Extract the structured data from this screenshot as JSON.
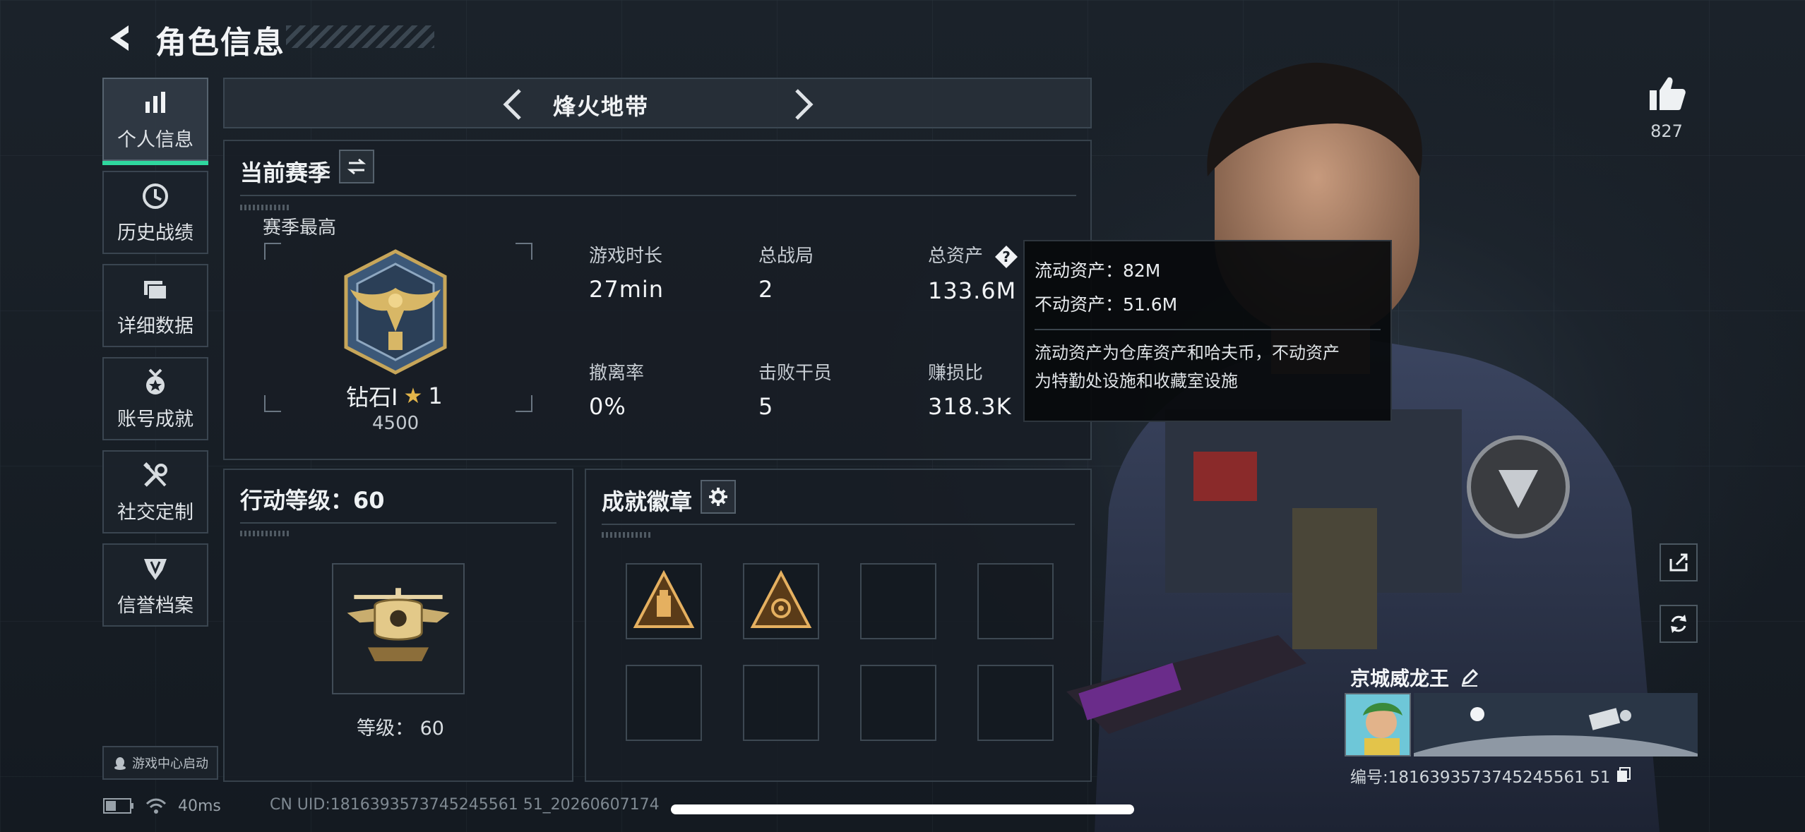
{
  "header": {
    "title": "角色信息"
  },
  "sidebar": {
    "items": [
      {
        "label": "个人信息",
        "icon": "bar-chart-icon",
        "active": true
      },
      {
        "label": "历史战绩",
        "icon": "clock-icon"
      },
      {
        "label": "详细数据",
        "icon": "folder-icon"
      },
      {
        "label": "账号成就",
        "icon": "medal-icon"
      },
      {
        "label": "社交定制",
        "icon": "tools-icon"
      },
      {
        "label": "信誉档案",
        "icon": "shield-badge-icon"
      }
    ],
    "game_center": "游戏中心启动"
  },
  "mode_selector": {
    "title": "烽火地带"
  },
  "season": {
    "title": "当前赛季",
    "best_label": "赛季最高",
    "rank_name": "钻石I",
    "rank_stars": "1",
    "rank_score": "4500",
    "stats": [
      {
        "label": "游戏时长",
        "value": "27min"
      },
      {
        "label": "总战局",
        "value": "2"
      },
      {
        "label": "总资产",
        "value": "133.6M"
      },
      {
        "label": "撤离率",
        "value": "0%"
      },
      {
        "label": "击败干员",
        "value": "5"
      },
      {
        "label": "赚损比",
        "value": "318.3K"
      }
    ]
  },
  "tooltip": {
    "liquid": "流动资产：82M",
    "fixed": "不动资产：51.6M",
    "desc_line1": "流动资产为仓库资产和哈夫币，不动资产",
    "desc_line2": "为特勤处设施和收藏室设施"
  },
  "level": {
    "title": "行动等级：60",
    "caption": "等级：  60"
  },
  "badges": {
    "title": "成就徽章",
    "slots_filled": 2,
    "slots_total": 8
  },
  "profile": {
    "likes": "827",
    "name": "京城威龙王",
    "id_label": "编号:1816393573745245561 51"
  },
  "status_bar": {
    "ping": "40ms",
    "uid": "CN UID:1816393573745245561 51_20260607174"
  },
  "colors": {
    "accent": "#2fd79e",
    "gold": "#e3b54a",
    "bg": "#151b22"
  }
}
